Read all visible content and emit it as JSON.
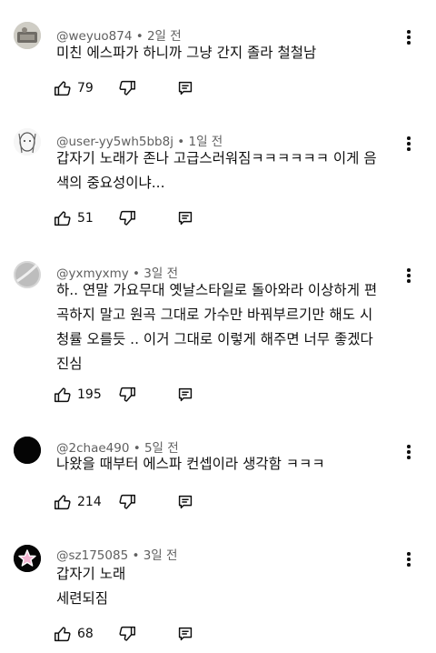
{
  "comments": [
    {
      "author": "@weyuo874",
      "time": "2일 전",
      "text": "미친 에스파가 하니까 그냥 간지 졸라 철철남",
      "likes": "79"
    },
    {
      "author": "@user-yy5wh5bb8j",
      "time": "1일 전",
      "text": "갑자기 노래가 존나 고급스러워짐ㅋㅋㅋㅋㅋㅋ 이게 음\n색의 중요성이냐...",
      "likes": "51"
    },
    {
      "author": "@yxmyxmy",
      "time": "3일 전",
      "text": "하.. 연말 가요무대 옛날스타일로 돌아와라 이상하게 편\n곡하지 말고 원곡 그대로 가수만 바꿔부르기만 해도 시\n청률 오를듯 .. 이거 그대로 이렇게 해주면 너무 좋겠다\n진심",
      "likes": "195"
    },
    {
      "author": "@2chae490",
      "time": "5일 전",
      "text": "나왔을 때부터 에스파 컨셉이라 생각함 ㅋㅋㅋ",
      "likes": "214"
    },
    {
      "author": "@sz175085",
      "time": "3일 전",
      "text": "갑자기 노래\n세련되짐",
      "likes": "68"
    }
  ],
  "separator": " • ",
  "icons": {
    "like": "thumbs-up-icon",
    "dislike": "thumbs-down-icon",
    "reply": "reply-icon",
    "more": "more-vert-icon"
  }
}
